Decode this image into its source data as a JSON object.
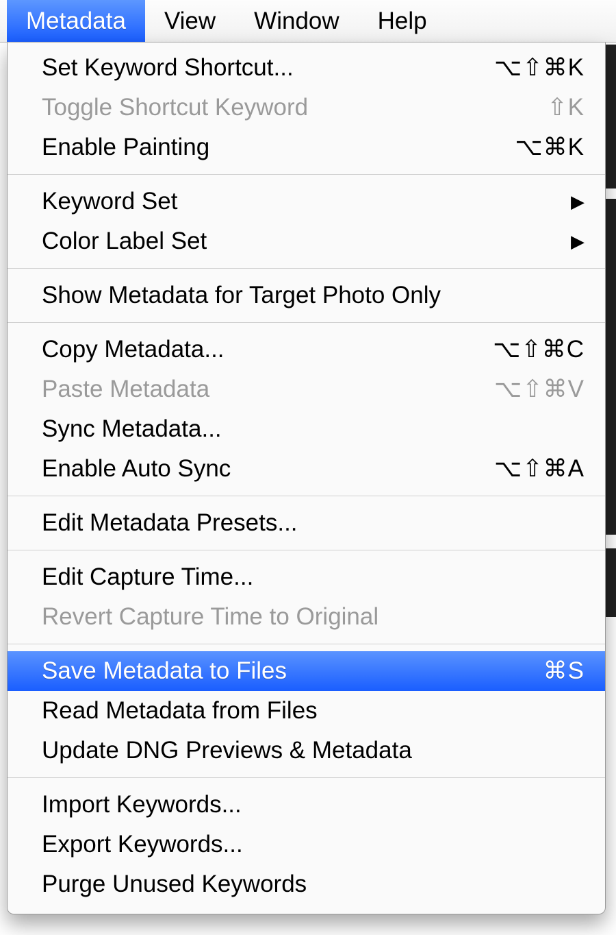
{
  "menubar": {
    "items": [
      {
        "label": "Metadata",
        "selected": true
      },
      {
        "label": "View"
      },
      {
        "label": "Window"
      },
      {
        "label": "Help"
      }
    ]
  },
  "menu": {
    "groups": [
      [
        {
          "id": "set-keyword-shortcut",
          "label": "Set Keyword Shortcut...",
          "shortcut": "⌥⇧⌘K",
          "disabled": false,
          "submenu": false,
          "highlighted": false
        },
        {
          "id": "toggle-shortcut-keyword",
          "label": "Toggle Shortcut Keyword",
          "shortcut": "⇧K",
          "disabled": true,
          "submenu": false,
          "highlighted": false
        },
        {
          "id": "enable-painting",
          "label": "Enable Painting",
          "shortcut": "⌥⌘K",
          "disabled": false,
          "submenu": false,
          "highlighted": false
        }
      ],
      [
        {
          "id": "keyword-set",
          "label": "Keyword Set",
          "shortcut": "",
          "disabled": false,
          "submenu": true,
          "highlighted": false
        },
        {
          "id": "color-label-set",
          "label": "Color Label Set",
          "shortcut": "",
          "disabled": false,
          "submenu": true,
          "highlighted": false
        }
      ],
      [
        {
          "id": "show-metadata-target-photo",
          "label": "Show Metadata for Target Photo Only",
          "shortcut": "",
          "disabled": false,
          "submenu": false,
          "highlighted": false
        }
      ],
      [
        {
          "id": "copy-metadata",
          "label": "Copy Metadata...",
          "shortcut": "⌥⇧⌘C",
          "disabled": false,
          "submenu": false,
          "highlighted": false
        },
        {
          "id": "paste-metadata",
          "label": "Paste Metadata",
          "shortcut": "⌥⇧⌘V",
          "disabled": true,
          "submenu": false,
          "highlighted": false
        },
        {
          "id": "sync-metadata",
          "label": "Sync Metadata...",
          "shortcut": "",
          "disabled": false,
          "submenu": false,
          "highlighted": false
        },
        {
          "id": "enable-auto-sync",
          "label": "Enable Auto Sync",
          "shortcut": "⌥⇧⌘A",
          "disabled": false,
          "submenu": false,
          "highlighted": false
        }
      ],
      [
        {
          "id": "edit-metadata-presets",
          "label": "Edit Metadata Presets...",
          "shortcut": "",
          "disabled": false,
          "submenu": false,
          "highlighted": false
        }
      ],
      [
        {
          "id": "edit-capture-time",
          "label": "Edit Capture Time...",
          "shortcut": "",
          "disabled": false,
          "submenu": false,
          "highlighted": false
        },
        {
          "id": "revert-capture-time",
          "label": "Revert Capture Time to Original",
          "shortcut": "",
          "disabled": true,
          "submenu": false,
          "highlighted": false
        }
      ],
      [
        {
          "id": "save-metadata-to-files",
          "label": "Save Metadata to Files",
          "shortcut": "⌘S",
          "disabled": false,
          "submenu": false,
          "highlighted": true
        },
        {
          "id": "read-metadata-from-files",
          "label": "Read Metadata from Files",
          "shortcut": "",
          "disabled": false,
          "submenu": false,
          "highlighted": false
        },
        {
          "id": "update-dng-previews",
          "label": "Update DNG Previews & Metadata",
          "shortcut": "",
          "disabled": false,
          "submenu": false,
          "highlighted": false
        }
      ],
      [
        {
          "id": "import-keywords",
          "label": "Import Keywords...",
          "shortcut": "",
          "disabled": false,
          "submenu": false,
          "highlighted": false
        },
        {
          "id": "export-keywords",
          "label": "Export Keywords...",
          "shortcut": "",
          "disabled": false,
          "submenu": false,
          "highlighted": false
        },
        {
          "id": "purge-unused-keywords",
          "label": "Purge Unused Keywords",
          "shortcut": "",
          "disabled": false,
          "submenu": false,
          "highlighted": false
        }
      ]
    ]
  }
}
